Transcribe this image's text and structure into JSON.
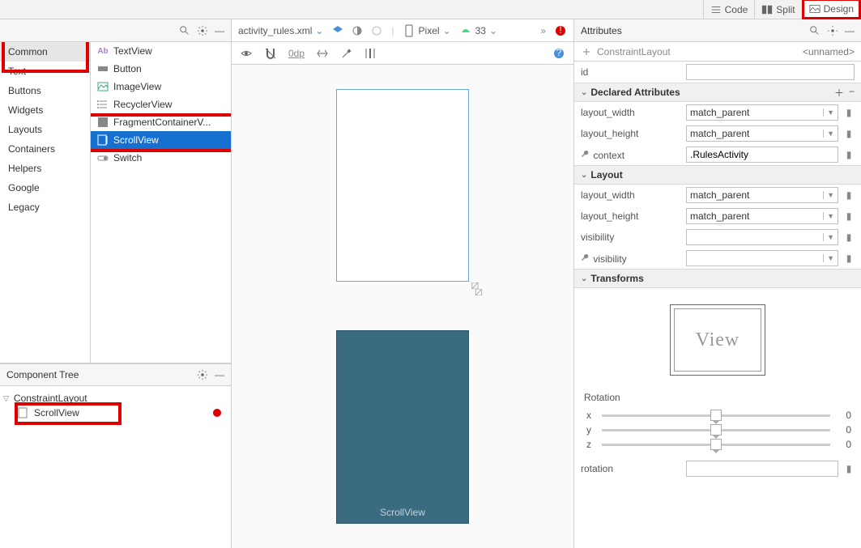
{
  "top_modes": {
    "code": "Code",
    "split": "Split",
    "design": "Design"
  },
  "palette": {
    "title": "",
    "categories": [
      "Common",
      "Text",
      "Buttons",
      "Widgets",
      "Layouts",
      "Containers",
      "Helpers",
      "Google",
      "Legacy"
    ],
    "selected_cat": "Common",
    "items": [
      {
        "label": "TextView",
        "icon": "textview"
      },
      {
        "label": "Button",
        "icon": "button"
      },
      {
        "label": "ImageView",
        "icon": "image"
      },
      {
        "label": "RecyclerView",
        "icon": "list"
      },
      {
        "label": "FragmentContainerV...",
        "icon": "fragment"
      },
      {
        "label": "ScrollView",
        "icon": "scroll",
        "selected": true
      },
      {
        "label": "Switch",
        "icon": "switch"
      }
    ]
  },
  "component_tree": {
    "title": "Component Tree",
    "root": "ConstraintLayout",
    "child": "ScrollView"
  },
  "center": {
    "filename": "activity_rules.xml",
    "device": "Pixel",
    "api": "33",
    "zero_dp": "0dp",
    "blueprint_label": "ScrollView"
  },
  "attributes": {
    "title": "Attributes",
    "breadcrumb": "ConstraintLayout",
    "unnamed": "<unnamed>",
    "id_label": "id",
    "id_value": "",
    "declared_hdr": "Declared Attributes",
    "declared": [
      {
        "name": "layout_width",
        "value": "match_parent",
        "combo": true
      },
      {
        "name": "layout_height",
        "value": "match_parent",
        "combo": true
      },
      {
        "name": "context",
        "value": ".RulesActivity",
        "wrench": true
      }
    ],
    "layout_hdr": "Layout",
    "layout": [
      {
        "name": "layout_width",
        "value": "match_parent",
        "combo": true
      },
      {
        "name": "layout_height",
        "value": "match_parent",
        "combo": true
      },
      {
        "name": "visibility",
        "value": "",
        "combo": true
      },
      {
        "name": "visibility",
        "value": "",
        "combo": true,
        "wrench": true
      }
    ],
    "transforms_hdr": "Transforms",
    "view_label": "View",
    "rotation_hdr": "Rotation",
    "rotation_axes": [
      "x",
      "y",
      "z"
    ],
    "rotation_value": "0",
    "rotation_label": "rotation"
  }
}
